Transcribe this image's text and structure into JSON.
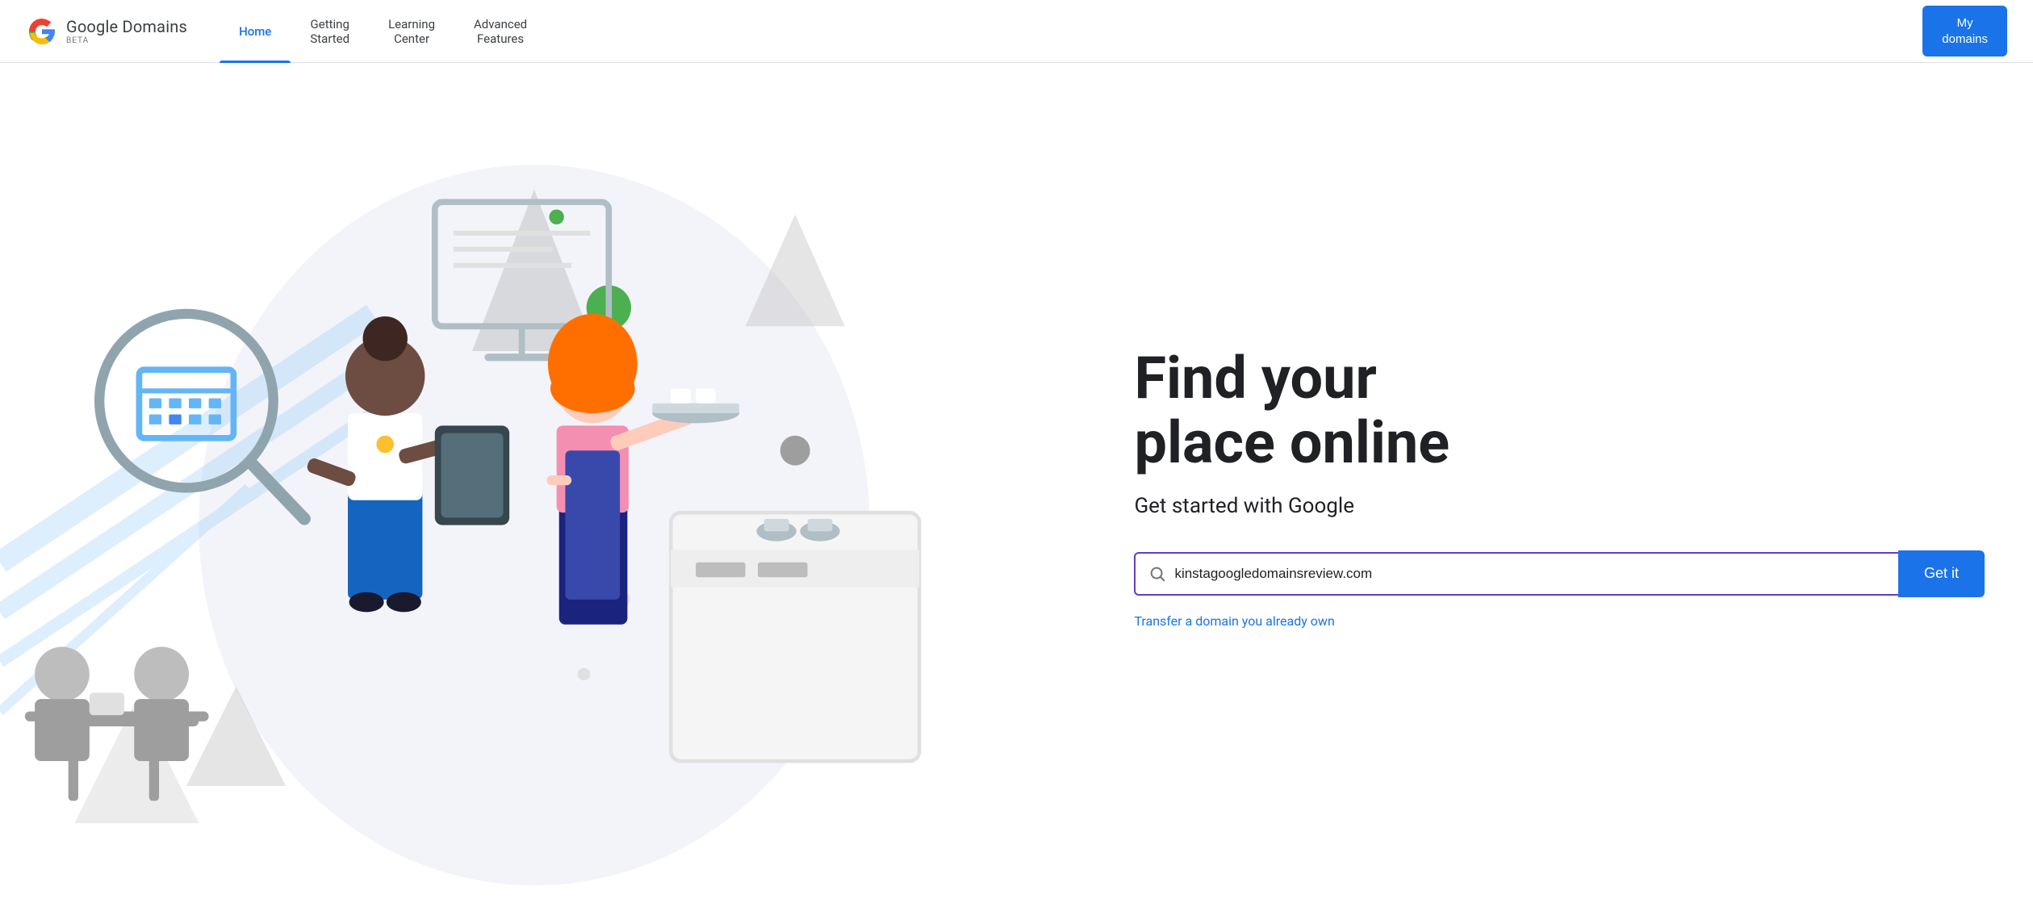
{
  "header": {
    "logo_name": "Google Domains",
    "logo_beta": "BETA",
    "nav_items": [
      {
        "label": "Home",
        "active": true
      },
      {
        "label": "Getting\nStarted",
        "active": false
      },
      {
        "label": "Learning\nCenter",
        "active": false
      },
      {
        "label": "Advanced\nFeatures",
        "active": false
      }
    ],
    "my_domains_btn": "My\ndomains"
  },
  "main": {
    "heading_line1": "Find your",
    "heading_line2": "place online",
    "subheading": "Get started with Google",
    "search_placeholder": "kinstagoogledomainsreview.com",
    "search_value": "kinstagoogledomainsreview.com",
    "get_it_label": "Get it",
    "transfer_label": "Transfer a domain you already own",
    "search_icon": "search-icon"
  },
  "colors": {
    "accent_blue": "#1a73e8",
    "accent_purple": "#5f3dc4",
    "nav_active": "#1a73e8",
    "text_primary": "#202124",
    "text_secondary": "#3c4043"
  }
}
